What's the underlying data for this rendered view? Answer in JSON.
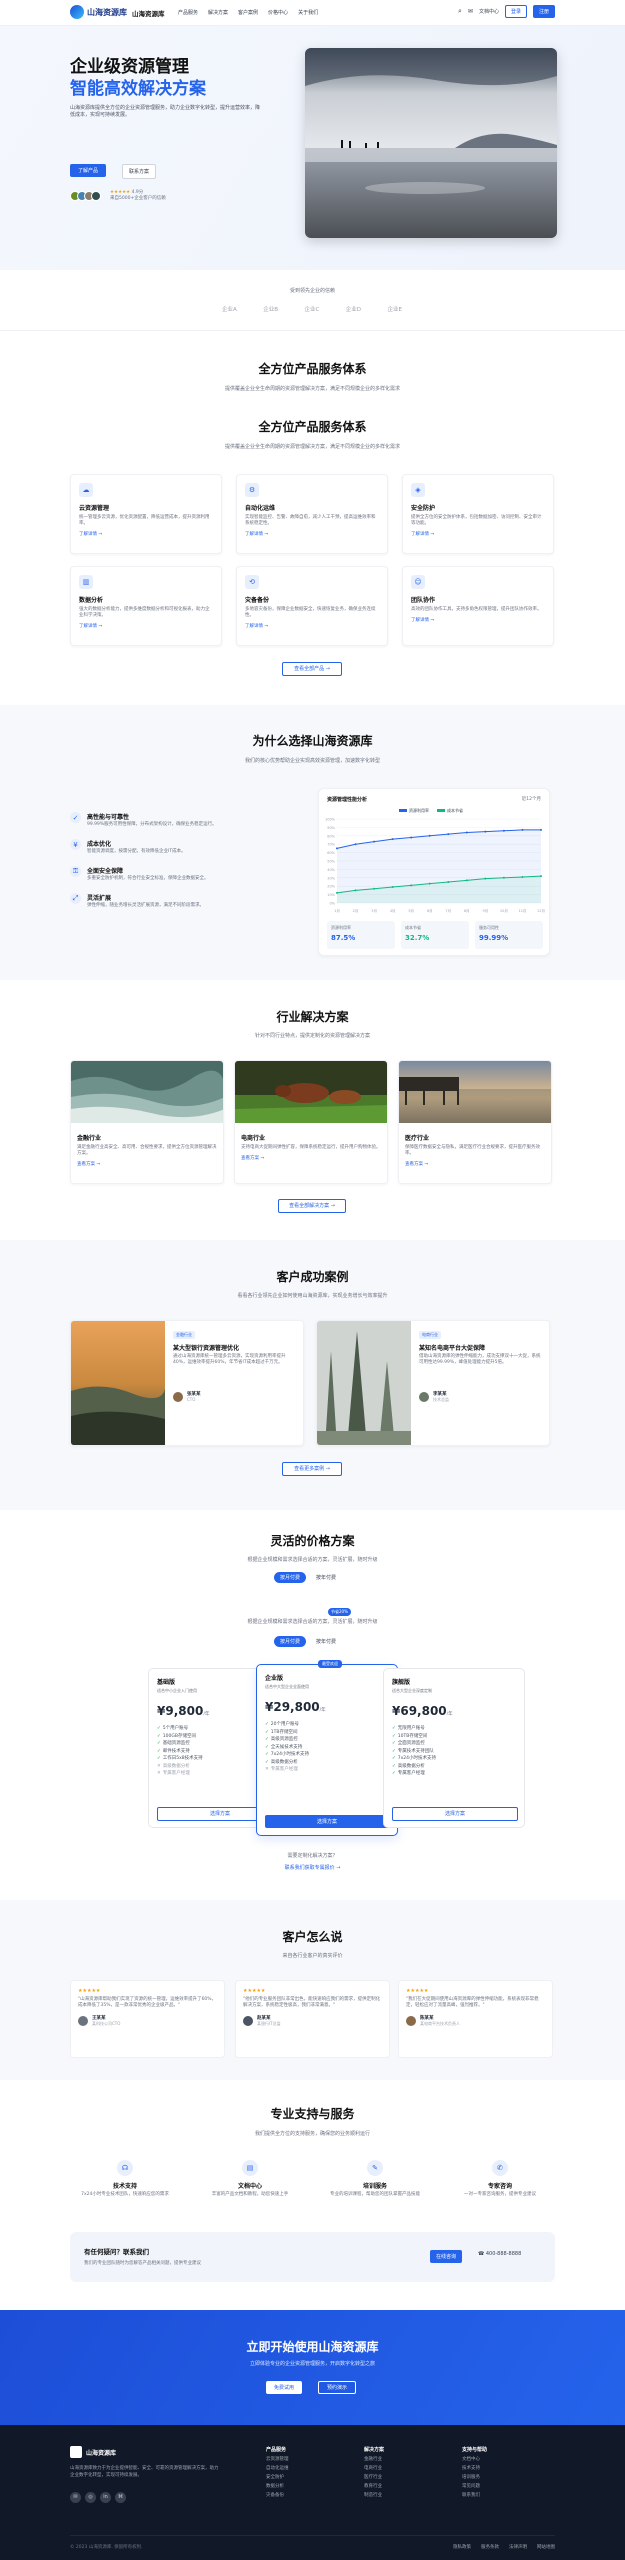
{
  "nav": {
    "logo_text": "山海资源库",
    "brand": "山海资源库",
    "menu": [
      "产品服务",
      "解决方案",
      "客户案例",
      "价格中心",
      "关于我们"
    ],
    "search_icon": "search-icon",
    "lang": "文档中心",
    "login": "登录",
    "register": "注册"
  },
  "hero": {
    "title1": "企业级资源管理",
    "title2": "智能高效解决方案",
    "desc": "山海资源库提供全方位的企业资源管理服务，助力企业数字化转型，提升运营效率，降低成本，实现可持续发展。",
    "cta_primary": "了解产品",
    "cta_secondary": "联系方案",
    "rating_stars": "★★★★★",
    "rating_value": "4.9分",
    "rating_text": "来自5000+企业客户的信赖"
  },
  "logos": {
    "caption": "受到领先企业的信赖",
    "items": [
      "企业A",
      "企业B",
      "企业C",
      "企业D",
      "企业E"
    ]
  },
  "services": {
    "title_a": "全方位产品服务体系",
    "sub_a": "提供覆盖企业全生命周期的资源管理解决方案，满足不同规模企业的多样化需求",
    "title_b": "全方位产品服务体系",
    "sub_b": "提供覆盖企业全生命周期的资源管理解决方案，满足不同规模企业的多样化需求",
    "cards": [
      {
        "icon": "cloud-icon",
        "title": "云资源管理",
        "desc": "统一管理多云资源，优化资源配置，降低运营成本，提升资源利用率。",
        "more": "了解详情 →"
      },
      {
        "icon": "automation-icon",
        "title": "自动化运维",
        "desc": "实现智能监控、告警、故障自愈，减少人工干预，提高运维效率和系统稳定性。",
        "more": "了解详情 →"
      },
      {
        "icon": "shield-icon",
        "title": "安全防护",
        "desc": "提供全方位的安全防护体系，包括数据加密、访问控制、安全审计等功能。",
        "more": "了解详情 →"
      },
      {
        "icon": "chart-icon",
        "title": "数据分析",
        "desc": "强大的数据分析能力，提供多维度数据分析和可视化报表，助力企业科学决策。",
        "more": "了解详情 →"
      },
      {
        "icon": "backup-icon",
        "title": "灾备备份",
        "desc": "多地容灾备份，保障企业数据安全，快速恢复业务，确保业务连续性。",
        "more": "了解详情 →"
      },
      {
        "icon": "team-icon",
        "title": "团队协作",
        "desc": "高效的团队协作工具，支持多角色权限管理，提升团队协作效率。",
        "more": "了解详情 →"
      }
    ],
    "more_btn": "查看全部产品 →"
  },
  "why": {
    "title": "为什么选择山海资源库",
    "sub": "我们的核心优势帮助企业实现高效资源管理，加速数字化转型",
    "features": [
      {
        "icon": "stability-icon",
        "title": "高性能与可靠性",
        "desc": "99.99%服务可用性保障，分布式架构设计，确保业务稳定运行。"
      },
      {
        "icon": "cost-icon",
        "title": "成本优化",
        "desc": "智能资源调度，按需分配，有效降低企业IT成本。"
      },
      {
        "icon": "lock-icon",
        "title": "全面安全保障",
        "desc": "多重安全防护机制，符合行业安全标准，保障企业数据安全。"
      },
      {
        "icon": "expand-icon",
        "title": "灵活扩展",
        "desc": "弹性伸缩，随业务增长灵活扩展资源，满足不同阶段需求。"
      }
    ],
    "chart_title": "资源管理性能分析",
    "chart_link": "近12个月",
    "chart_legend": [
      "资源利用率",
      "成本节省"
    ],
    "stats": [
      {
        "label": "资源利用率",
        "value": "87.5%"
      },
      {
        "label": "成本节省",
        "value": "32.7%"
      },
      {
        "label": "服务可用性",
        "value": "99.99%"
      }
    ]
  },
  "chart_data": {
    "type": "line",
    "title": "资源管理性能分析",
    "x": [
      "1月",
      "2月",
      "3月",
      "4月",
      "5月",
      "6月",
      "7月",
      "8月",
      "9月",
      "10月",
      "11月",
      "12月"
    ],
    "ylim": [
      0,
      100
    ],
    "yticks": [
      0,
      10,
      20,
      30,
      40,
      50,
      60,
      70,
      80,
      90,
      100
    ],
    "series": [
      {
        "name": "资源利用率",
        "color": "#2563eb",
        "values": [
          65,
          70,
          73,
          76,
          78,
          80,
          82,
          84,
          85,
          86,
          87,
          87
        ]
      },
      {
        "name": "成本节省",
        "color": "#10b981",
        "values": [
          12,
          15,
          17,
          19,
          21,
          23,
          25,
          27,
          29,
          30,
          31,
          32
        ]
      }
    ]
  },
  "industry": {
    "title": "行业解决方案",
    "sub": "针对不同行业特点，提供定制化的资源管理解决方案",
    "cards": [
      {
        "title": "金融行业",
        "desc": "满足金融行业高安全、高可用、合规性要求，提供全方位资源管理解决方案。",
        "more": "查看方案 →"
      },
      {
        "title": "电商行业",
        "desc": "支持电商大促期间弹性扩容，保障系统稳定运行，提升用户购物体验。",
        "more": "查看方案 →"
      },
      {
        "title": "医疗行业",
        "desc": "保障医疗数据安全与隐私，满足医疗行业合规要求，提升医疗服务效率。",
        "more": "查看方案 →"
      }
    ],
    "more_btn": "查看全部解决方案 →"
  },
  "cases": {
    "title": "客户成功案例",
    "sub": "看看各行业领先企业如何使用山海资源库，实现业务增长与效率提升",
    "items": [
      {
        "tag": "金融行业",
        "title": "某大型银行资源管理优化",
        "desc": "通过山海资源库统一管理多云资源，实现资源利用率提升40%，运维效率提升60%，年节省IT成本超过千万元。",
        "person": "张某某",
        "role": "CTO"
      },
      {
        "tag": "电商行业",
        "title": "某知名电商平台大促保障",
        "desc": "借助山海资源库的弹性伸缩能力，成功支撑双十一大促，系统可用性达99.99%，峰值处理能力提升5倍。",
        "person": "李某某",
        "role": "技术总监"
      }
    ],
    "more_btn": "查看更多案例 →"
  },
  "pricing": {
    "title": "灵活的价格方案",
    "sub": "根据企业规模和需求选择合适的方案，灵活扩展，随时升级",
    "tab_month": "按月付费",
    "tab_year": "按年付费",
    "sub2": "根据企业规模和需求选择合适的方案，灵活扩展，随时升级",
    "tab_month2": "按月付费",
    "tab_year2": "按年付费",
    "discount": "节省20%",
    "popular": "最受欢迎",
    "plans": [
      {
        "name": "基础版",
        "desc": "适合中小企业入门使用",
        "price": "¥9,800",
        "unit": "/年",
        "features": [
          "5个用户账号",
          "100GB存储空间",
          "基础资源监控",
          "邮件技术支持",
          "工作日5x8技术支持",
          "高级数据分析",
          "专属客户经理"
        ],
        "enabled": [
          true,
          true,
          true,
          true,
          true,
          false,
          false
        ],
        "btn": "选择方案"
      },
      {
        "name": "企业版",
        "desc": "适合中大型企业全面使用",
        "price": "¥29,800",
        "unit": "/年",
        "features": [
          "20个用户账号",
          "1TB存储空间",
          "高级资源监控",
          "全天候技术支持",
          "7x24小时技术支持",
          "高级数据分析",
          "专属客户经理"
        ],
        "enabled": [
          true,
          true,
          true,
          true,
          true,
          true,
          false
        ],
        "btn": "选择方案"
      },
      {
        "name": "旗舰版",
        "desc": "适合大型企业深度定制",
        "price": "¥69,800",
        "unit": "/年",
        "features": [
          "无限用户账号",
          "10TB存储空间",
          "全面资源监控",
          "专属技术支持团队",
          "7x24小时技术支持",
          "高级数据分析",
          "专属客户经理"
        ],
        "enabled": [
          true,
          true,
          true,
          true,
          true,
          true,
          true
        ],
        "btn": "选择方案"
      }
    ],
    "custom_q": "需要定制化解决方案？",
    "custom_link": "联系我们获取专属报价 →"
  },
  "testimonials": {
    "title": "客户怎么说",
    "sub": "来自各行业客户的真实评价",
    "items": [
      {
        "stars": "★★★★★",
        "text": "\"山海资源库帮助我们实现了资源的统一管理，运维效率提升了60%，成本降低了35%，是一款非常优秀的企业级产品。\"",
        "name": "王某某",
        "role": "某科技公司CTO"
      },
      {
        "stars": "★★★★★",
        "text": "\"他们的专业服务团队非常出色，能快速响应我们的需求，提供定制化解决方案，系统稳定性极高，我们非常满意。\"",
        "name": "赵某某",
        "role": "某银行IT总监"
      },
      {
        "stars": "★★★★★",
        "text": "\"我们在大促期间使用山海资源库的弹性伸缩功能，系统表现非常稳定，轻松应对了流量高峰，强烈推荐。\"",
        "name": "陈某某",
        "role": "某电商平台技术负责人"
      }
    ]
  },
  "support": {
    "title": "专业支持与服务",
    "sub": "我们提供全方位的支持服务，确保您的业务顺利运行",
    "items": [
      {
        "icon": "headset-icon",
        "title": "技术支持",
        "desc": "7x24小时专业技术团队，快速响应您的需求"
      },
      {
        "icon": "doc-icon",
        "title": "文档中心",
        "desc": "丰富的产品文档和教程，助您快速上手"
      },
      {
        "icon": "training-icon",
        "title": "培训服务",
        "desc": "专业的培训课程，帮助您的团队掌握产品技能"
      },
      {
        "icon": "consult-icon",
        "title": "专家咨询",
        "desc": "一对一专家咨询服务，提供专业建议"
      }
    ],
    "banner_title": "有任何疑问？联系我们",
    "banner_desc": "我们的专业团队随时为您解答产品相关问题，提供专业建议",
    "banner_btn": "在线咨询",
    "phone": "400-888-8888"
  },
  "cta": {
    "title": "立即开始使用山海资源库",
    "sub": "立即体验专业的企业资源管理服务，开启数字化转型之旅",
    "primary": "免费试用",
    "secondary": "预约演示"
  },
  "footer": {
    "logo_text": "山海资源库",
    "desc": "山海资源库致力于为企业提供智能、安全、可靠的资源管理解决方案，助力企业数字化转型，实现可持续发展。",
    "social": [
      "wechat-icon",
      "weibo-icon",
      "linkedin-icon",
      "github-icon"
    ],
    "cols": [
      {
        "h": "产品服务",
        "items": [
          "云资源管理",
          "自动化运维",
          "安全防护",
          "数据分析",
          "灾备备份"
        ]
      },
      {
        "h": "解决方案",
        "items": [
          "金融行业",
          "电商行业",
          "医疗行业",
          "教育行业",
          "制造行业"
        ]
      },
      {
        "h": "支持与帮助",
        "items": [
          "文档中心",
          "技术支持",
          "培训服务",
          "常见问题",
          "联系我们"
        ]
      }
    ],
    "copyright": "© 2023 山海资源库. 保留所有权利.",
    "links": [
      "隐私政策",
      "服务条款",
      "法律声明",
      "网站地图"
    ]
  }
}
